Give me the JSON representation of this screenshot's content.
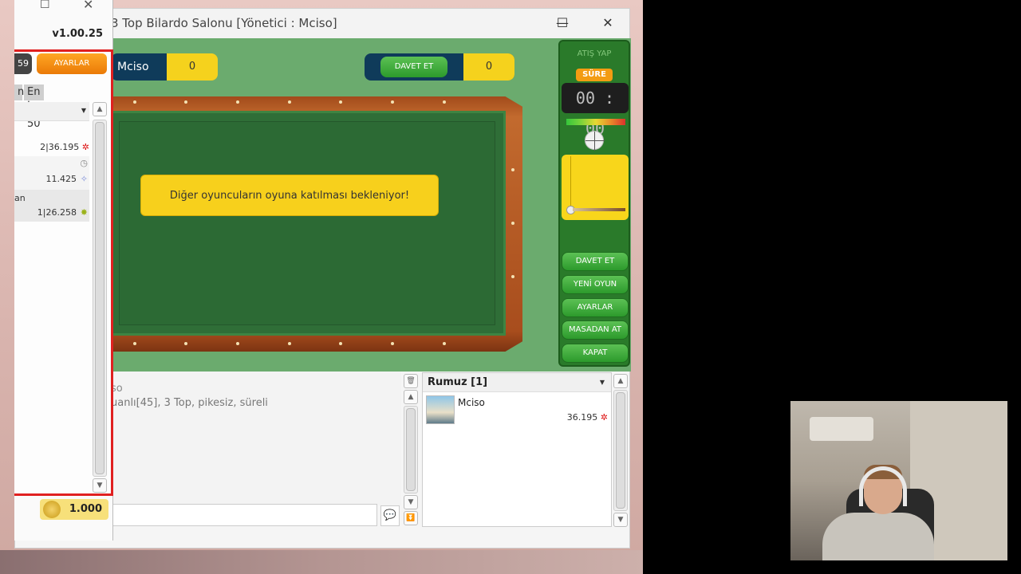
{
  "window": {
    "title": "3 Top Bilardo Salonu [Yönetici : Mciso]",
    "minimize": "☐",
    "maximize": "☐",
    "close": "✕"
  },
  "scoreboard": {
    "player_name": "Mciso",
    "player_score": "0",
    "invite_label": "DAVET ET",
    "opponent_score": "0"
  },
  "table_message": "Diğer  oyuncuların  oyuna katılması  bekleniyor!",
  "side_panel": {
    "shoot_label": "ATIŞ YAP",
    "time_label": "SÜRE",
    "timer": "00 : 00",
    "buttons": [
      "DAVET ET",
      "YENİ OYUN",
      "AYARLAR",
      "MASADAN AT",
      "KAPAT"
    ]
  },
  "chat": {
    "line1": "so",
    "line2": "uanlı[45], 3 Top, pikesiz, süreli",
    "input_placeholder": ""
  },
  "players_panel": {
    "header": "Rumuz [1]",
    "players": [
      {
        "name": "Mciso",
        "score": "36.195"
      }
    ]
  },
  "left_window": {
    "version": "v1.00.25",
    "badge": "59",
    "settings_label": "AYARLAR",
    "tab_partial": "n",
    "tab_top50": "En İyi 50",
    "rows": [
      {
        "text": "2|36.195"
      },
      {
        "text": "11.425"
      },
      {
        "text": "an"
      },
      {
        "text": "1|26.258"
      }
    ],
    "coins": "1.000"
  },
  "colors": {
    "felt": "#2f6e37",
    "game_bg": "#6bab6e",
    "accent_yellow": "#f5d21d",
    "accent_red": "#e02020"
  }
}
